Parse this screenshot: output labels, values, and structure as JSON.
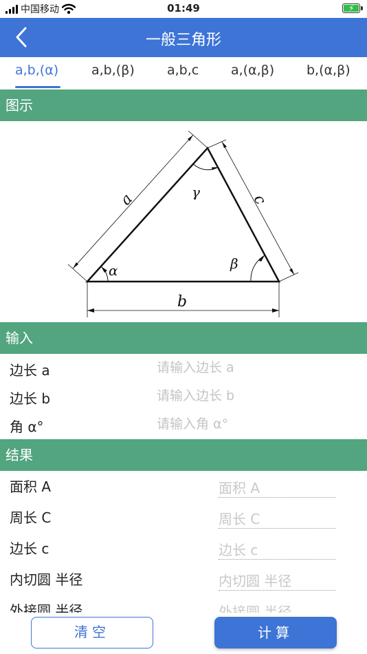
{
  "status_bar": {
    "carrier": "中国移动",
    "time": "01:49"
  },
  "nav": {
    "title": "一般三角形"
  },
  "tabs": [
    {
      "label": "a,b,(α)",
      "active": true
    },
    {
      "label": "a,b,(β)",
      "active": false
    },
    {
      "label": "a,b,c",
      "active": false
    },
    {
      "label": "a,(α,β)",
      "active": false
    },
    {
      "label": "b,(α,β)",
      "active": false
    }
  ],
  "sections": {
    "diagram": "图示",
    "input": "输入",
    "result": "结果"
  },
  "diagram": {
    "labels": {
      "a": "a",
      "b": "b",
      "c": "c",
      "alpha": "α",
      "beta": "β",
      "gamma": "γ"
    }
  },
  "inputs": [
    {
      "label": "边长 a",
      "placeholder": "请输入边长 a",
      "value": ""
    },
    {
      "label": "边长 b",
      "placeholder": "请输入边长 b",
      "value": ""
    },
    {
      "label": "角 α°",
      "placeholder": "请输入角 α°",
      "value": ""
    }
  ],
  "results": [
    {
      "label": "面积 A",
      "placeholder": "面积 A"
    },
    {
      "label": "周长 C",
      "placeholder": "周长 C"
    },
    {
      "label": "边长 c",
      "placeholder": "边长 c"
    },
    {
      "label": "内切圆 半径",
      "placeholder": "内切圆 半径"
    },
    {
      "label": "外接圆 半径",
      "placeholder": "外接圆 半径"
    }
  ],
  "buttons": {
    "clear": "清空",
    "calculate": "计算"
  },
  "colors": {
    "nav_blue": "#3d74d6",
    "section_green": "#52a57f",
    "battery_green": "#2fbf4a"
  }
}
